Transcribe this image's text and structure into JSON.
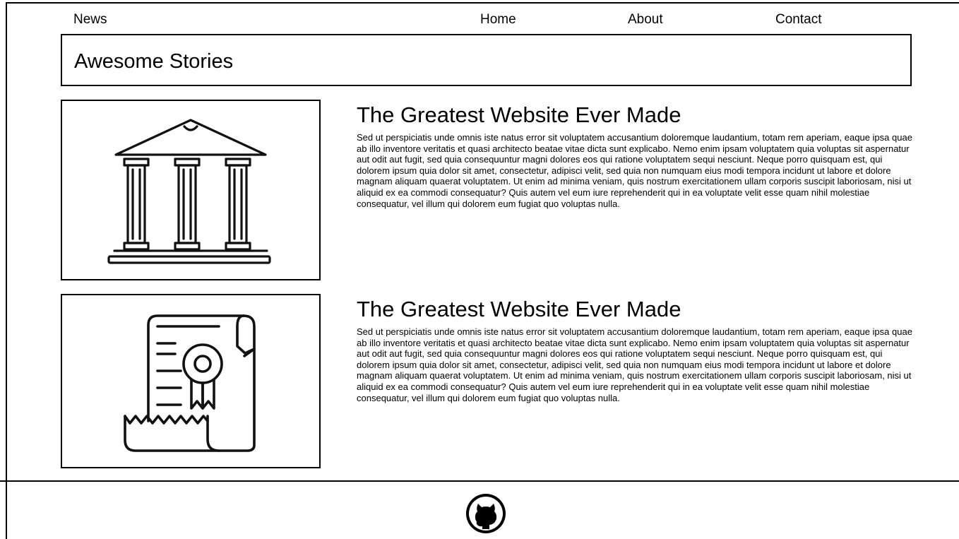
{
  "nav": {
    "brand": "News",
    "links": [
      "Home",
      "About",
      "Contact"
    ]
  },
  "banner": {
    "title": "Awesome Stories"
  },
  "stories": [
    {
      "icon": "bank-building-icon",
      "title": "The Greatest Website Ever Made",
      "body": "Sed ut perspiciatis unde omnis iste natus error sit voluptatem accusantium doloremque laudantium, totam rem aperiam, eaque ipsa quae ab illo inventore veritatis et quasi architecto beatae vitae dicta sunt explicabo. Nemo enim ipsam voluptatem quia voluptas sit aspernatur aut odit aut fugit, sed quia consequuntur magni dolores eos qui ratione voluptatem sequi nesciunt. Neque porro quisquam est, qui dolorem ipsum quia dolor sit amet, consectetur, adipisci velit, sed quia non numquam eius modi tempora incidunt ut labore et dolore magnam aliquam quaerat voluptatem. Ut enim ad minima veniam, quis nostrum exercitationem ullam corporis suscipit laboriosam, nisi ut aliquid ex ea commodi consequatur? Quis autem vel eum iure reprehenderit qui in ea voluptate velit esse quam nihil molestiae consequatur, vel illum qui dolorem eum fugiat quo voluptas nulla."
    },
    {
      "icon": "certificate-scroll-icon",
      "title": "The Greatest Website Ever Made",
      "body": "Sed ut perspiciatis unde omnis iste natus error sit voluptatem accusantium doloremque laudantium, totam rem aperiam, eaque ipsa quae ab illo inventore veritatis et quasi architecto beatae vitae dicta sunt explicabo. Nemo enim ipsam voluptatem quia voluptas sit aspernatur aut odit aut fugit, sed quia consequuntur magni dolores eos qui ratione voluptatem sequi nesciunt. Neque porro quisquam est, qui dolorem ipsum quia dolor sit amet, consectetur, adipisci velit, sed quia non numquam eius modi tempora incidunt ut labore et dolore magnam aliquam quaerat voluptatem. Ut enim ad minima veniam, quis nostrum exercitationem ullam corporis suscipit laboriosam, nisi ut aliquid ex ea commodi consequatur? Quis autem vel eum iure reprehenderit qui in ea voluptate velit esse quam nihil molestiae consequatur, vel illum qui dolorem eum fugiat quo voluptas nulla."
    }
  ],
  "footer": {
    "icon": "github-icon"
  }
}
